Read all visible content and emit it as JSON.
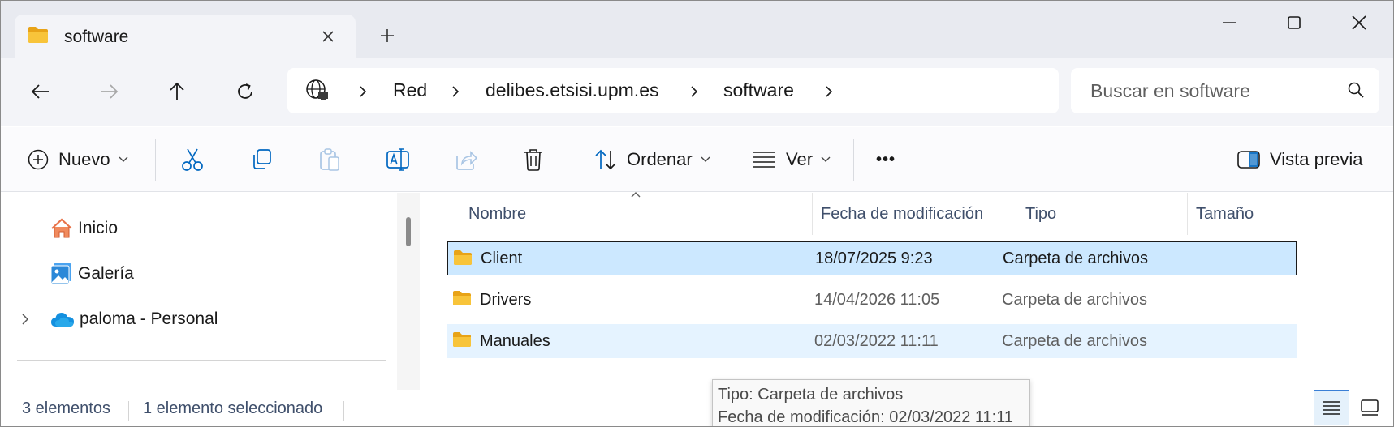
{
  "tab": {
    "title": "software",
    "new_tab_symbol": "+"
  },
  "address": {
    "breadcrumbs": [
      "Red",
      "delibes.etsisi.upm.es",
      "software"
    ]
  },
  "search": {
    "placeholder": "Buscar en software"
  },
  "commands": {
    "new_label": "Nuevo",
    "sort_label": "Ordenar",
    "view_label": "Ver",
    "more_label": "•••",
    "preview_label": "Vista previa"
  },
  "nav": {
    "items": [
      {
        "label": "Inicio",
        "icon": "home-icon"
      },
      {
        "label": "Galería",
        "icon": "gallery-icon"
      },
      {
        "label": "paloma - Personal",
        "icon": "onedrive-icon"
      }
    ]
  },
  "columns": {
    "name": "Nombre",
    "date": "Fecha de modificación",
    "type": "Tipo",
    "size": "Tamaño"
  },
  "files": [
    {
      "name": "Client",
      "date": "18/07/2025 9:23",
      "type": "Carpeta de archivos",
      "size": "",
      "state": "selected"
    },
    {
      "name": "Drivers",
      "date": "14/04/2026 11:05",
      "type": "Carpeta de archivos",
      "size": "",
      "state": "normal"
    },
    {
      "name": "Manuales",
      "date": "02/03/2022 11:11",
      "type": "Carpeta de archivos",
      "size": "",
      "state": "hover"
    }
  ],
  "status": {
    "count": "3 elementos",
    "selection": "1 elemento seleccionado"
  },
  "tooltip": {
    "line1": "Tipo: Carpeta de archivos",
    "line2": "Fecha de modificación: 02/03/2022 11:11"
  },
  "colors": {
    "accent": "#0067c0",
    "selection": "#cce8ff",
    "hover": "#e5f3ff",
    "folder": "#f8c43a"
  }
}
